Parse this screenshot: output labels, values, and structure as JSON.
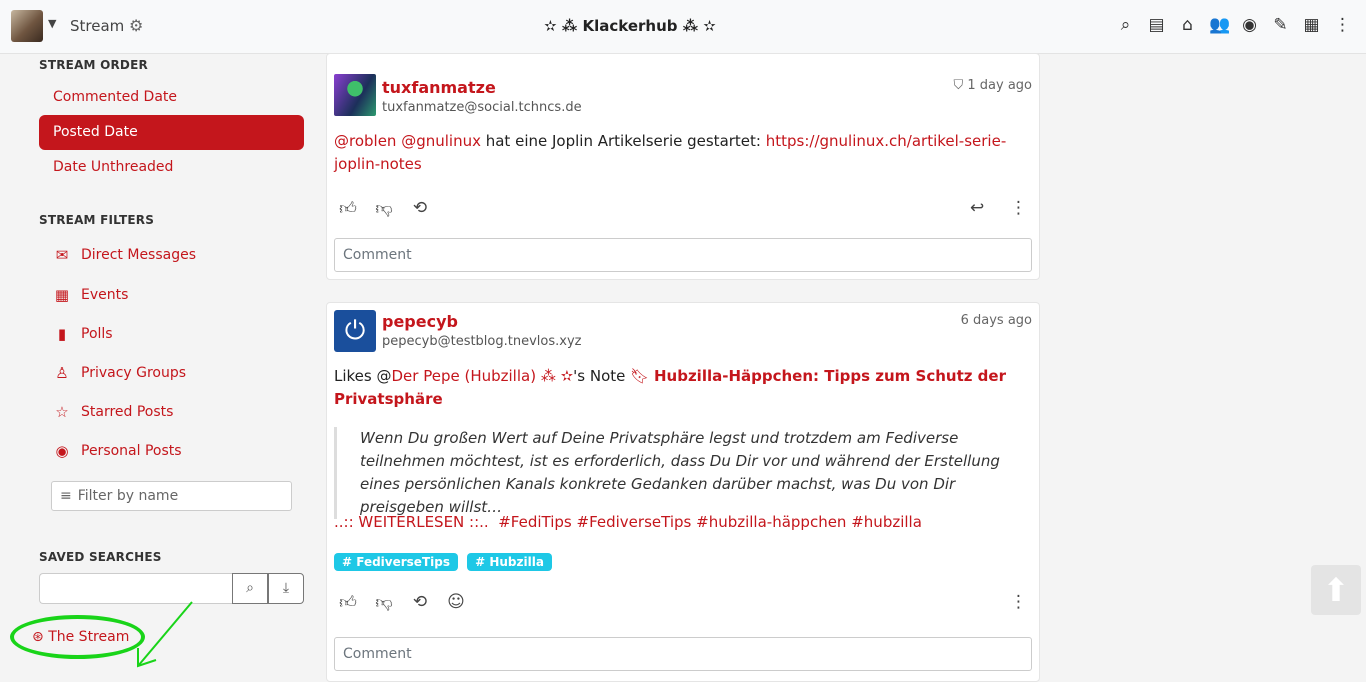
{
  "navbar": {
    "title": "Stream",
    "brand": "✫ ⁂ Klackerhub ⁂ ✫",
    "icons": [
      "search-icon",
      "news-icon",
      "home-icon",
      "contacts-icon",
      "profile-icon",
      "edit-icon",
      "apps-icon",
      "more-icon"
    ],
    "icon_glyphs": [
      "⌕",
      "▤",
      "⌂",
      "👥",
      "◉",
      "✎",
      "▦",
      "⋮"
    ]
  },
  "sidebar": {
    "order_title": "STREAM ORDER",
    "order_items": [
      "Commented Date",
      "Posted Date",
      "Date Unthreaded"
    ],
    "filters_title": "STREAM FILTERS",
    "filters": [
      {
        "label": "Direct Messages",
        "icon": "envelope-icon",
        "glyph": "✉"
      },
      {
        "label": "Events",
        "icon": "calendar-icon",
        "glyph": "▦"
      },
      {
        "label": "Polls",
        "icon": "poll-icon",
        "glyph": "▮"
      },
      {
        "label": "Privacy Groups",
        "icon": "person-icon",
        "glyph": "♙"
      },
      {
        "label": "Starred Posts",
        "icon": "star-icon",
        "glyph": "☆"
      },
      {
        "label": "Personal Posts",
        "icon": "person-circle-icon",
        "glyph": "◉"
      }
    ],
    "filter_placeholder": "Filter by name",
    "saved_title": "SAVED SEARCHES",
    "saved_link": "The Stream"
  },
  "posts": [
    {
      "author": "tuxfanmatze",
      "address": "tuxfanmatze@social.tchncs.de",
      "time": "1 day ago",
      "mentions": "@roblen @gnulinux",
      "text": " hat eine Joplin Artikelserie gestartet: ",
      "link": "https://gnulinux.ch/artikel-serie-joplin-notes",
      "comment_placeholder": "Comment"
    },
    {
      "author": "pepecyb",
      "address": "pepecyb@testblog.tnevlos.xyz",
      "time": "6 days ago",
      "likes_prefix": "Likes @",
      "liked_author": "Der Pepe (Hubzilla) ⁂ ✫",
      "note_suffix": "'s Note",
      "note_title": "Hubzilla-Häppchen: Tipps zum Schutz der Privatsphäre",
      "quote": "Wenn Du großen Wert auf Deine Privatsphäre legst und trotzdem am Fediverse teilnehmen möchtest, ist es erforderlich, dass Du Dir vor und während der Erstellung eines persönlichen Kanals konkrete Gedanken darüber machst, was Du von Dir preisgeben willst…",
      "readmore": "..:: WEITERLESEN ::..",
      "hashtags": [
        "#FediTips",
        "#FediverseTips",
        "#hubzilla-häppchen",
        "#hubzilla"
      ],
      "tags": [
        "FediverseTips",
        "Hubzilla"
      ],
      "comment_placeholder": "Comment"
    }
  ]
}
